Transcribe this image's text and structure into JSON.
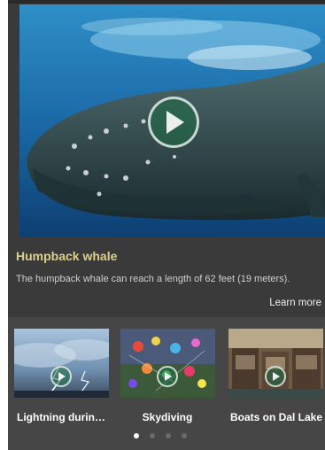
{
  "featured": {
    "title": "Humpback whale",
    "description": "The humpback whale can reach a length of 62 feet (19 meters).",
    "learn_more": "Learn more",
    "play_icon": "play-icon"
  },
  "carousel": {
    "items": [
      {
        "label": "Lightning durin…",
        "image": "lightning-storm-image"
      },
      {
        "label": "Skydiving",
        "image": "skydiving-image"
      },
      {
        "label": "Boats on Dal Lake",
        "image": "boats-image"
      }
    ],
    "pages": 4,
    "active_page": 1
  },
  "colors": {
    "title": "#ddd08a",
    "background": "#3a3a3a",
    "carousel_bg": "#464646"
  }
}
